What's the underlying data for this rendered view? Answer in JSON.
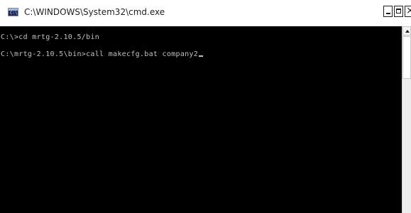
{
  "window": {
    "title": "C:\\WINDOWS\\System32\\cmd.exe",
    "app_icon": "console-app-icon",
    "controls": {
      "minimize_icon": "minimize-icon",
      "maximize_icon": "maximize-icon",
      "close_icon": "close-icon"
    }
  },
  "console": {
    "lines": [
      "C:\\>cd mrtg-2.10.5/bin",
      "C:\\mrtg-2.10.5\\bin>call makecfg.bat company2"
    ],
    "background_color": "#000000",
    "text_color": "#c0c0c0"
  },
  "scrollbar": {
    "up_arrow_icon": "scroll-up-arrow-icon"
  }
}
